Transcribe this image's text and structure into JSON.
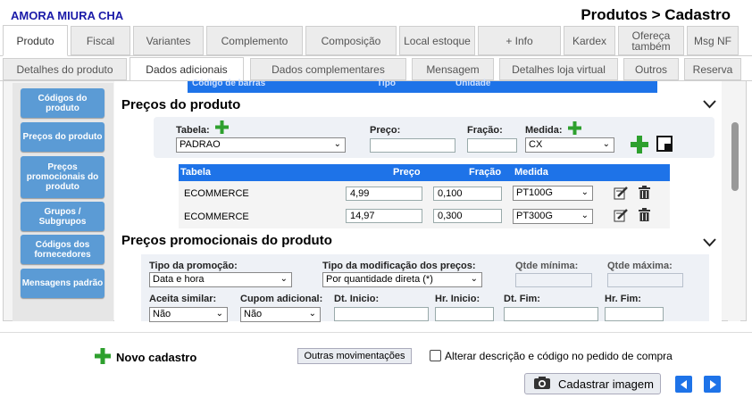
{
  "header": {
    "company": "AMORA MIURA CHA",
    "title": "Produtos > Cadastro"
  },
  "tabs1": [
    "Produto",
    "Fiscal",
    "Variantes",
    "Complemento",
    "Composição",
    "Local estoque",
    "+ Info",
    "Kardex",
    "Ofereça também",
    "Msg NF"
  ],
  "tabs2": [
    "Detalhes do produto",
    "Dados adicionais",
    "Dados complementares",
    "Mensagem",
    "Detalhes loja virtual",
    "Outros",
    "Reserva"
  ],
  "sidebar": [
    "Códigos do produto",
    "Preços do produto",
    "Preços promocionais do produto",
    "Grupos / Subgrupos",
    "Códigos dos fornecedores",
    "Mensagens padrão"
  ],
  "topstrip": {
    "col1": "Código de barras",
    "col2": "Tipo",
    "col3": "Unidade"
  },
  "precos": {
    "title": "Preços do produto",
    "tabela_label": "Tabela:",
    "tabela_value": "PADRAO",
    "preco_label": "Preço:",
    "preco_value": "",
    "fracao_label": "Fração:",
    "fracao_value": "",
    "medida_label": "Medida:",
    "medida_value": "CX",
    "table": {
      "headers": [
        "Tabela",
        "Preço",
        "Fração",
        "Medida"
      ],
      "rows": [
        {
          "tabela": "ECOMMERCE",
          "preco": "4,99",
          "fracao": "0,100",
          "medida": "PT100G"
        },
        {
          "tabela": "ECOMMERCE",
          "preco": "14,97",
          "fracao": "0,300",
          "medida": "PT300G"
        }
      ]
    }
  },
  "promo": {
    "title": "Preços promocionais do produto",
    "tipo_label": "Tipo da promoção:",
    "tipo_value": "Data e hora",
    "tipo_mod_label": "Tipo da modificação dos preços:",
    "tipo_mod_value": "Por quantidade direta (*)",
    "qtde_min_label": "Qtde mínima:",
    "qtde_max_label": "Qtde máxima:",
    "aceita_label": "Aceita similar:",
    "aceita_value": "Não",
    "cupom_label": "Cupom adicional:",
    "cupom_value": "Não",
    "dt_inicio_label": "Dt. Inicio:",
    "hr_inicio_label": "Hr. Inicio:",
    "dt_fim_label": "Dt. Fim:",
    "hr_fim_label": "Hr. Fim:"
  },
  "footer": {
    "novo": "Novo cadastro",
    "outras": "Outras movimentações",
    "alterar": "Alterar descrição e código no pedido de compra",
    "cadastrar_imagem": "Cadastrar imagem"
  },
  "colors": {
    "accent": "#1e73e8",
    "sidebar": "#5b9bd5",
    "company": "#1a1aa8",
    "green": "#2ea02e"
  },
  "icons": [
    "plus-icon",
    "save-icon",
    "edit-icon",
    "trash-icon",
    "chevron-down-icon",
    "camera-icon",
    "arrow-left-icon",
    "arrow-right-icon"
  ]
}
